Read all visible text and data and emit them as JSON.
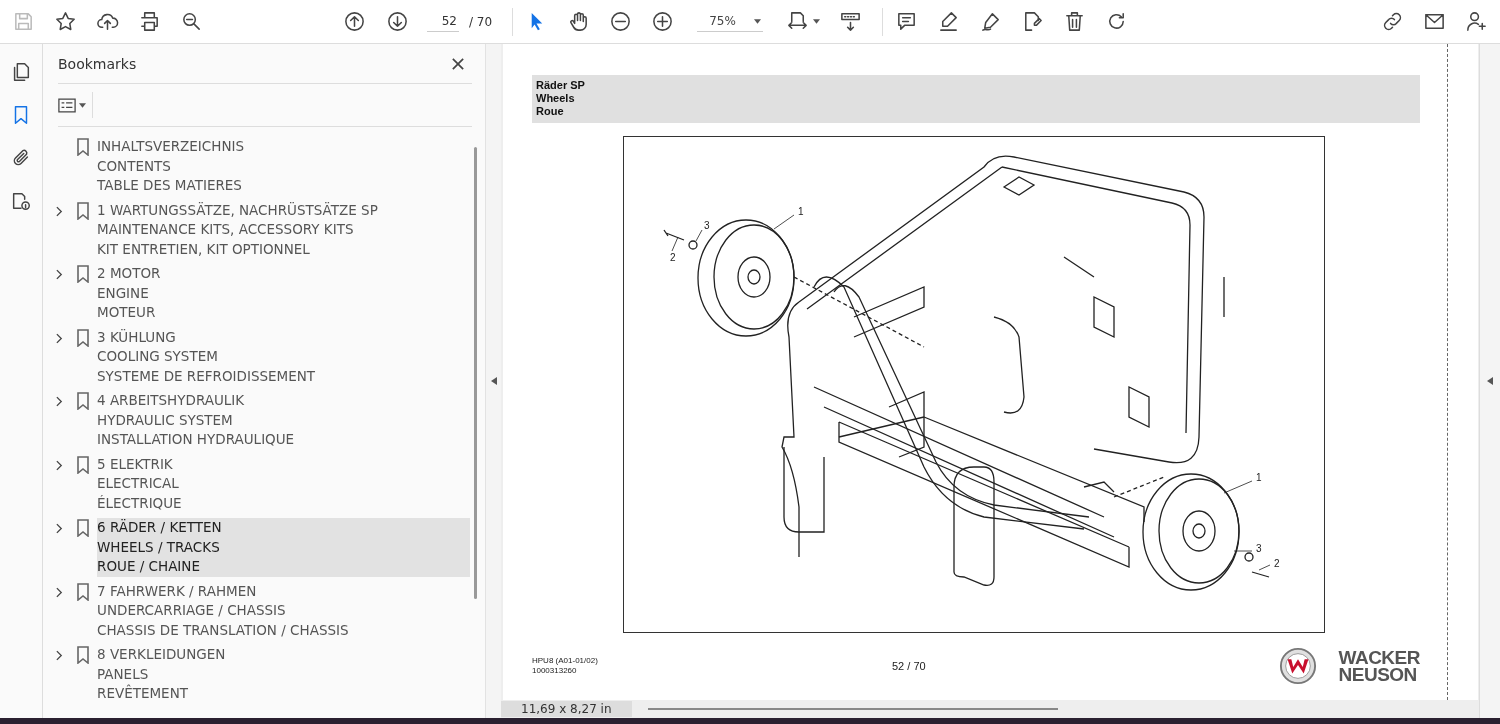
{
  "toolbar": {
    "file_tools": [
      {
        "kind": "save",
        "disabled": true
      },
      {
        "kind": "star",
        "disabled": false
      },
      {
        "kind": "upload",
        "disabled": false
      },
      {
        "kind": "print",
        "disabled": false
      },
      {
        "kind": "zoom-search",
        "disabled": false
      }
    ],
    "nav_tools": [
      {
        "kind": "up"
      },
      {
        "kind": "down"
      }
    ],
    "page_number": "52",
    "page_count": "/ 70",
    "view_tools": [
      {
        "kind": "select",
        "selected": true
      },
      {
        "kind": "hand",
        "selected": false
      },
      {
        "kind": "minus",
        "selected": false
      },
      {
        "kind": "plus",
        "selected": false
      }
    ],
    "zoom": "75%",
    "layout_tools": [
      {
        "kind": "fit"
      },
      {
        "kind": "scroll"
      }
    ],
    "annotate_tools": [
      {
        "kind": "comment"
      },
      {
        "kind": "highlight"
      },
      {
        "kind": "sign"
      },
      {
        "kind": "edit"
      },
      {
        "kind": "trash"
      },
      {
        "kind": "redo"
      }
    ],
    "share_tools": [
      {
        "kind": "link"
      },
      {
        "kind": "mail"
      },
      {
        "kind": "person-add"
      }
    ]
  },
  "rail": [
    {
      "kind": "pages",
      "selected": false
    },
    {
      "kind": "bookmark",
      "selected": true
    },
    {
      "kind": "attachment",
      "selected": false
    },
    {
      "kind": "file-info",
      "selected": false
    }
  ],
  "bookmarks": {
    "title": "Bookmarks",
    "items": [
      {
        "lines": [
          "INHALTSVERZEICHNIS",
          "CONTENTS",
          "TABLE DES MATIERES"
        ],
        "expandable": false,
        "selected": false
      },
      {
        "lines": [
          "1 WARTUNGSSÄTZE, NACHRÜSTSÄTZE SP",
          "MAINTENANCE KITS, ACCESSORY KITS",
          "KIT ENTRETIEN, KIT OPTIONNEL"
        ],
        "expandable": true,
        "selected": false
      },
      {
        "lines": [
          "2 MOTOR",
          "ENGINE",
          "MOTEUR"
        ],
        "expandable": true,
        "selected": false
      },
      {
        "lines": [
          "3 KÜHLUNG",
          "COOLING SYSTEM",
          "SYSTEME DE REFROIDISSEMENT"
        ],
        "expandable": true,
        "selected": false
      },
      {
        "lines": [
          "4 ARBEITSHYDRAULIK",
          "HYDRAULIC SYSTEM",
          "INSTALLATION HYDRAULIQUE"
        ],
        "expandable": true,
        "selected": false
      },
      {
        "lines": [
          "5 ELEKTRIK",
          "ELECTRICAL",
          "ÉLECTRIQUE"
        ],
        "expandable": true,
        "selected": false
      },
      {
        "lines": [
          "6 RÄDER / KETTEN",
          "WHEELS / TRACKS",
          "ROUE / CHAINE"
        ],
        "expandable": true,
        "selected": true
      },
      {
        "lines": [
          "7 FAHRWERK / RAHMEN",
          "UNDERCARRIAGE / CHASSIS",
          "CHASSIS DE TRANSLATION / CHASSIS"
        ],
        "expandable": true,
        "selected": false
      },
      {
        "lines": [
          "8 VERKLEIDUNGEN",
          "PANELS",
          "REVÊTEMENT"
        ],
        "expandable": true,
        "selected": false
      }
    ]
  },
  "document": {
    "header_lines": [
      "Räder SP",
      "Wheels",
      "Roue"
    ],
    "callouts": [
      "1",
      "3",
      "2",
      "1",
      "3",
      "2"
    ],
    "footer_code": [
      "HPU8 (A01-01/02)",
      "1000313260"
    ],
    "page_label": "52 / 70",
    "brand": [
      "WACKER",
      "NEUSON"
    ]
  },
  "status_bar": {
    "page_size": "11,69 x 8,27 in"
  }
}
